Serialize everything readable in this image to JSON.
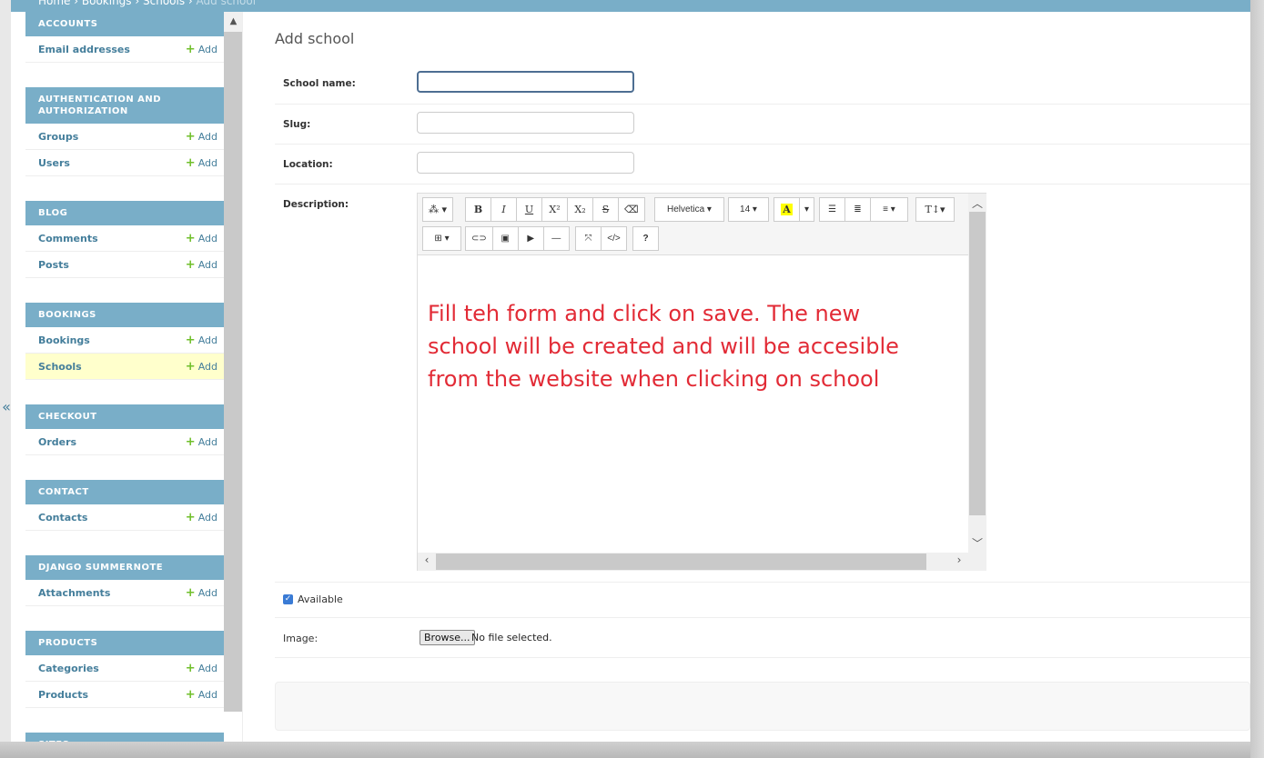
{
  "breadcrumbs": [
    "Home",
    "Bookings",
    "Schools",
    "Add school"
  ],
  "collapse_symbol": "«",
  "sidebar": {
    "add_label": "Add",
    "modules": [
      {
        "caption": "Accounts",
        "items": [
          "Email addresses"
        ]
      },
      {
        "caption": "Authentication and Authorization",
        "items": [
          "Groups",
          "Users"
        ]
      },
      {
        "caption": "Blog",
        "items": [
          "Comments",
          "Posts"
        ]
      },
      {
        "caption": "Bookings",
        "items": [
          "Bookings",
          "Schools"
        ],
        "active": "Schools"
      },
      {
        "caption": "Checkout",
        "items": [
          "Orders"
        ]
      },
      {
        "caption": "Contact",
        "items": [
          "Contacts"
        ]
      },
      {
        "caption": "Django Summernote",
        "items": [
          "Attachments"
        ]
      },
      {
        "caption": "Products",
        "items": [
          "Categories",
          "Products"
        ]
      },
      {
        "caption": "Sites",
        "items": []
      }
    ]
  },
  "page": {
    "title": "Add school",
    "fields": {
      "school_name": "School name:",
      "slug": "Slug:",
      "location": "Location:",
      "description": "Description:",
      "available": "Available",
      "image": "Image:"
    },
    "browse_label": "Browse...",
    "no_file": "No file selected."
  },
  "editor": {
    "font_name": "Helvetica",
    "font_size": "14",
    "content": "Fill teh form and click on save. The new school will be created and will be accesible from the website when clicking on school"
  },
  "icons": [
    "magic-icon",
    "bold-icon",
    "italic-icon",
    "underline-icon",
    "superscript-icon",
    "subscript-icon",
    "strikethrough-icon",
    "eraser-icon",
    "highlight-icon",
    "bullet-list-icon",
    "numbered-list-icon",
    "align-icon",
    "line-height-icon",
    "table-icon",
    "link-icon",
    "picture-icon",
    "video-icon",
    "hr-icon",
    "fullscreen-icon",
    "code-icon",
    "help-icon"
  ],
  "colors": {
    "header": "#79aec8",
    "link": "#447e9b",
    "add_plus": "#70bf2b",
    "active_row": "#ffffcc",
    "editor_text": "#e22b36"
  }
}
